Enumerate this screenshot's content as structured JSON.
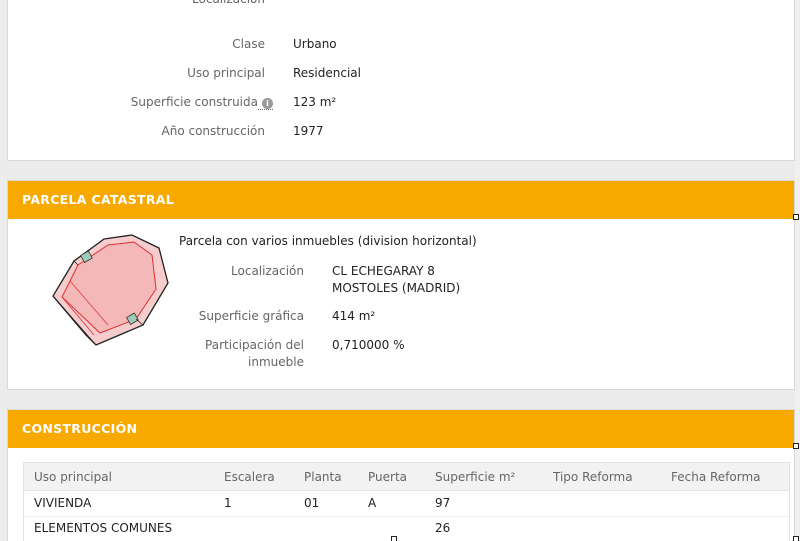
{
  "inmueble": {
    "cut_label": "Localización",
    "rows": [
      {
        "label": "Clase",
        "value": "Urbano"
      },
      {
        "label": "Uso principal",
        "value": "Residencial"
      },
      {
        "label": "Superficie construida",
        "value": "123 m²"
      },
      {
        "label": "Año construcción",
        "value": "1977"
      }
    ]
  },
  "parcela": {
    "header": "PARCELA CATASTRAL",
    "description": "Parcela con varios inmuebles (division horizontal)",
    "localizacion_label": "Localización",
    "localizacion_line1": "CL ECHEGARAY 8",
    "localizacion_line2": "MOSTOLES (MADRID)",
    "superficie_label": "Superficie gráfica",
    "superficie_value": "414 m²",
    "participacion_label_1": "Participación del",
    "participacion_label_2": "inmueble",
    "participacion_value": "0,710000 %"
  },
  "construccion": {
    "header": "CONSTRUCCIÓN",
    "columns": [
      "Uso principal",
      "Escalera",
      "Planta",
      "Puerta",
      "Superficie m²",
      "Tipo Reforma",
      "Fecha Reforma"
    ],
    "rows": [
      [
        "VIVIENDA",
        "1",
        "01",
        "A",
        "97",
        "",
        ""
      ],
      [
        "ELEMENTOS COMUNES",
        "",
        "",
        "",
        "26",
        "",
        ""
      ]
    ]
  },
  "colors": {
    "accent": "#f7a900",
    "parcel_fill": "#f6c9c9",
    "parcel_line": "#e03030"
  }
}
